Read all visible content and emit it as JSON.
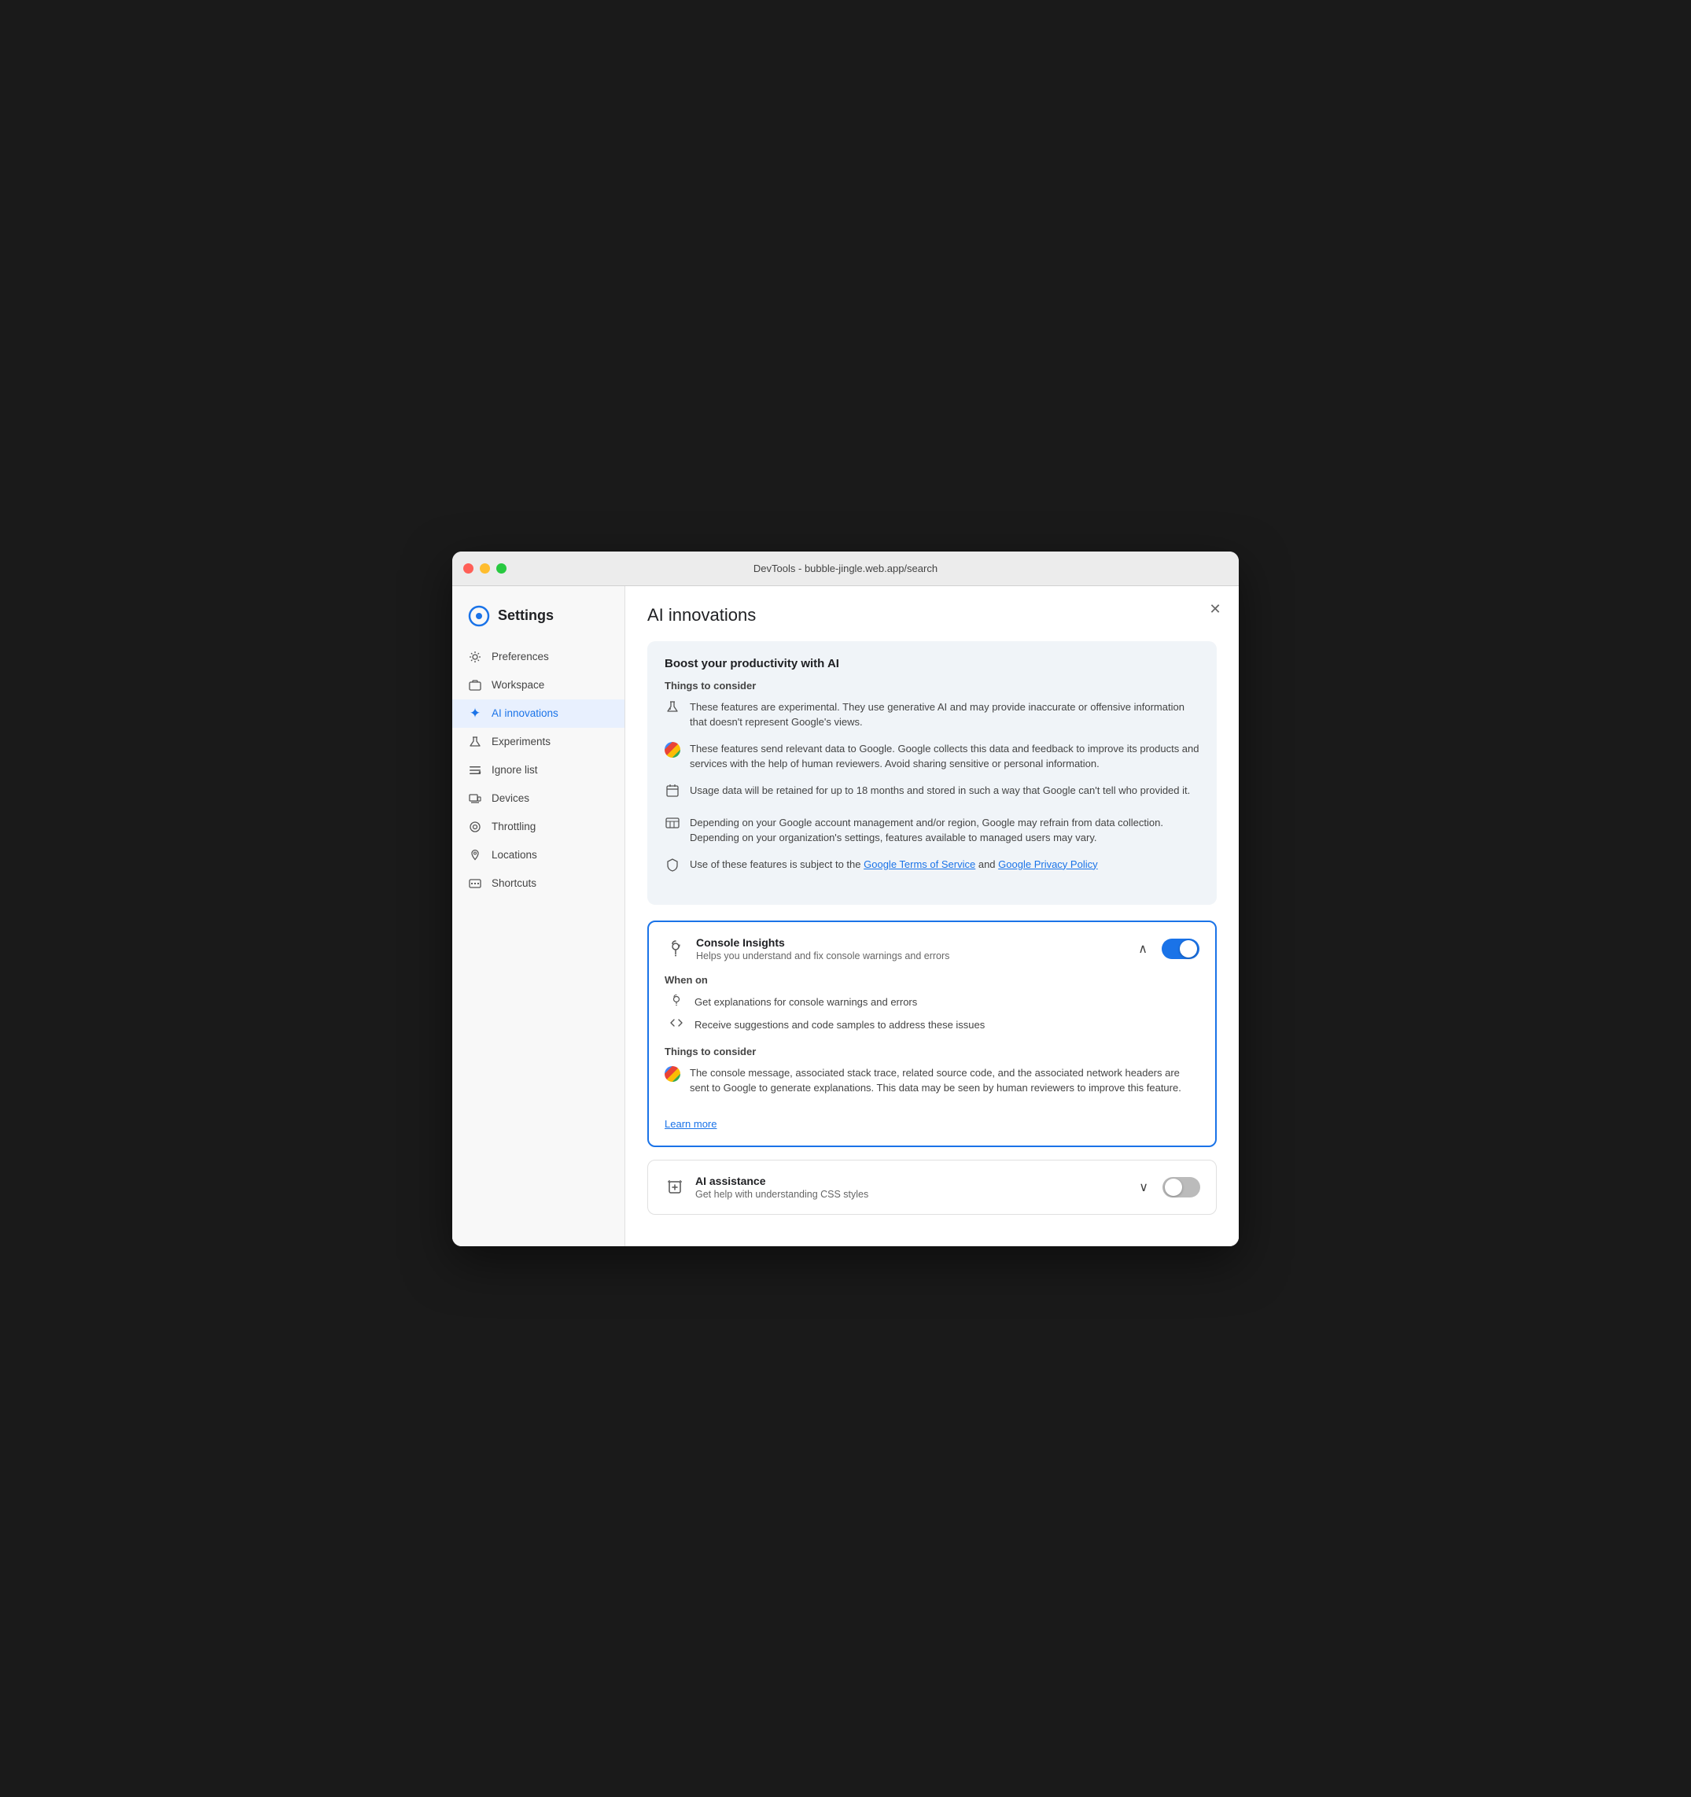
{
  "titlebar": {
    "title": "DevTools - bubble-jingle.web.app/search"
  },
  "sidebar": {
    "header": {
      "title": "Settings"
    },
    "items": [
      {
        "id": "preferences",
        "label": "Preferences",
        "icon": "⚙"
      },
      {
        "id": "workspace",
        "label": "Workspace",
        "icon": "📁"
      },
      {
        "id": "ai-innovations",
        "label": "AI innovations",
        "icon": "✦",
        "active": true
      },
      {
        "id": "experiments",
        "label": "Experiments",
        "icon": "⚗"
      },
      {
        "id": "ignore-list",
        "label": "Ignore list",
        "icon": "≡✗"
      },
      {
        "id": "devices",
        "label": "Devices",
        "icon": "□"
      },
      {
        "id": "throttling",
        "label": "Throttling",
        "icon": "◎"
      },
      {
        "id": "locations",
        "label": "Locations",
        "icon": "◉"
      },
      {
        "id": "shortcuts",
        "label": "Shortcuts",
        "icon": "⌨"
      }
    ]
  },
  "content": {
    "title": "AI innovations",
    "close_button": "✕",
    "info_card": {
      "title": "Boost your productivity with AI",
      "subtitle": "Things to consider",
      "items": [
        {
          "icon": "🧠",
          "text": "These features are experimental. They use generative AI and may provide inaccurate or offensive information that doesn't represent Google's views."
        },
        {
          "icon": "G",
          "text": "These features send relevant data to Google. Google collects this data and feedback to improve its products and services with the help of human reviewers. Avoid sharing sensitive or personal information."
        },
        {
          "icon": "📅",
          "text": "Usage data will be retained for up to 18 months and stored in such a way that Google can't tell who provided it."
        },
        {
          "icon": "📋",
          "text": "Depending on your Google account management and/or region, Google may refrain from data collection. Depending on your organization's settings, features available to managed users may vary."
        },
        {
          "icon": "🛡",
          "text_before": "Use of these features is subject to the ",
          "link1_text": "Google Terms of Service",
          "link1_url": "#",
          "text_middle": " and ",
          "link2_text": "Google Privacy Policy",
          "link2_url": "#"
        }
      ]
    },
    "console_insights": {
      "title": "Console Insights",
      "subtitle": "Helps you understand and fix console warnings and errors",
      "enabled": true,
      "when_on": {
        "title": "When on",
        "items": [
          {
            "icon": "💡",
            "text": "Get explanations for console warnings and errors"
          },
          {
            "icon": "<>",
            "text": "Receive suggestions and code samples to address these issues"
          }
        ]
      },
      "things_to_consider": {
        "title": "Things to consider",
        "items": [
          {
            "icon": "G",
            "text": "The console message, associated stack trace, related source code, and the associated network headers are sent to Google to generate explanations. This data may be seen by human reviewers to improve this feature."
          }
        ]
      },
      "learn_more": "Learn more"
    },
    "ai_assistance": {
      "title": "AI assistance",
      "subtitle": "Get help with understanding CSS styles",
      "enabled": false
    }
  }
}
